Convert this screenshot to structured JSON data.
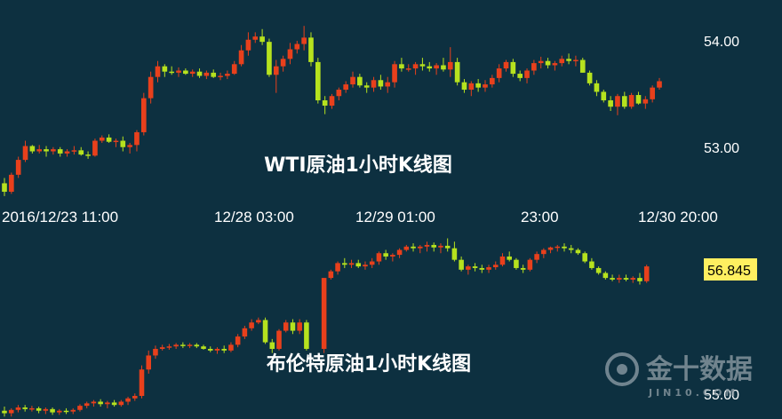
{
  "colors": {
    "background": "#0d3040",
    "up": "#e8401c",
    "down": "#b6e21e",
    "badge": "#ffef60"
  },
  "x_axis": {
    "tick_labels": [
      "2016/12/23 11:00",
      "12/28 03:00",
      "12/29 01:00",
      "23:00",
      "12/30 20:00"
    ]
  },
  "watermark": {
    "name": "金十数据",
    "sub": "JIN10.COM",
    "icon": "jin10-logo-icon"
  },
  "chart_data": [
    {
      "type": "candlestick",
      "title": "WTI原油1小时K线图",
      "yticks": [
        53.0,
        54.0
      ],
      "ytick_labels": [
        "53.00",
        "54.00"
      ],
      "ylim": [
        52.62,
        54.34
      ],
      "grid": false,
      "candles": [
        [
          52.8,
          52.85,
          52.68,
          52.72
        ],
        [
          52.72,
          52.9,
          52.7,
          52.88
        ],
        [
          52.88,
          53.05,
          52.85,
          53.02
        ],
        [
          53.02,
          53.2,
          53.0,
          53.15
        ],
        [
          53.15,
          53.16,
          53.08,
          53.1
        ],
        [
          53.1,
          53.16,
          53.08,
          53.12
        ],
        [
          53.12,
          53.15,
          53.05,
          53.1
        ],
        [
          53.1,
          53.14,
          53.07,
          53.12
        ],
        [
          53.12,
          53.14,
          53.05,
          53.08
        ],
        [
          53.08,
          53.12,
          53.05,
          53.1
        ],
        [
          53.1,
          53.15,
          53.07,
          53.11
        ],
        [
          53.11,
          53.14,
          53.06,
          53.07
        ],
        [
          53.07,
          53.1,
          53.03,
          53.06
        ],
        [
          53.06,
          53.22,
          53.05,
          53.2
        ],
        [
          53.2,
          53.25,
          53.18,
          53.23
        ],
        [
          53.23,
          53.26,
          53.18,
          53.19
        ],
        [
          53.19,
          53.22,
          53.14,
          53.2
        ],
        [
          53.2,
          53.24,
          53.1,
          53.14
        ],
        [
          53.14,
          53.18,
          53.08,
          53.16
        ],
        [
          53.16,
          53.3,
          53.1,
          53.28
        ],
        [
          53.28,
          53.65,
          53.25,
          53.6
        ],
        [
          53.6,
          53.85,
          53.55,
          53.8
        ],
        [
          53.8,
          53.95,
          53.75,
          53.9
        ],
        [
          53.9,
          53.92,
          53.8,
          53.85
        ],
        [
          53.85,
          53.9,
          53.82,
          53.84
        ],
        [
          53.84,
          53.89,
          53.8,
          53.86
        ],
        [
          53.86,
          53.88,
          53.82,
          53.83
        ],
        [
          53.83,
          53.87,
          53.8,
          53.85
        ],
        [
          53.85,
          53.88,
          53.79,
          53.81
        ],
        [
          53.81,
          53.86,
          53.78,
          53.84
        ],
        [
          53.84,
          53.87,
          53.79,
          53.8
        ],
        [
          53.8,
          53.84,
          53.77,
          53.81
        ],
        [
          53.81,
          53.86,
          53.78,
          53.83
        ],
        [
          53.83,
          53.95,
          53.82,
          53.92
        ],
        [
          53.92,
          54.1,
          53.9,
          54.05
        ],
        [
          54.05,
          54.22,
          54.0,
          54.15
        ],
        [
          54.15,
          54.22,
          54.12,
          54.18
        ],
        [
          54.18,
          54.25,
          54.1,
          54.13
        ],
        [
          54.13,
          54.16,
          53.8,
          53.82
        ],
        [
          53.82,
          53.96,
          53.65,
          53.9
        ],
        [
          53.9,
          54.0,
          53.85,
          53.97
        ],
        [
          53.97,
          54.12,
          53.92,
          54.06
        ],
        [
          54.06,
          54.14,
          54.02,
          54.11
        ],
        [
          54.11,
          54.28,
          54.05,
          54.17
        ],
        [
          54.17,
          54.22,
          53.9,
          53.94
        ],
        [
          53.94,
          53.98,
          53.55,
          53.58
        ],
        [
          53.58,
          53.62,
          53.45,
          53.53
        ],
        [
          53.53,
          53.64,
          53.5,
          53.62
        ],
        [
          53.62,
          53.7,
          53.58,
          53.68
        ],
        [
          53.68,
          53.76,
          53.65,
          53.73
        ],
        [
          53.73,
          53.85,
          53.7,
          53.8
        ],
        [
          53.8,
          53.83,
          53.7,
          53.72
        ],
        [
          53.72,
          53.75,
          53.65,
          53.7
        ],
        [
          53.7,
          53.8,
          53.66,
          53.77
        ],
        [
          53.77,
          53.82,
          53.68,
          53.71
        ],
        [
          53.71,
          53.8,
          53.65,
          53.75
        ],
        [
          53.75,
          53.95,
          53.7,
          53.92
        ],
        [
          53.92,
          53.98,
          53.85,
          53.88
        ],
        [
          53.88,
          53.92,
          53.85,
          53.88
        ],
        [
          53.88,
          53.94,
          53.82,
          53.92
        ],
        [
          53.92,
          53.98,
          53.86,
          53.9
        ],
        [
          53.9,
          53.94,
          53.85,
          53.88
        ],
        [
          53.88,
          53.93,
          53.82,
          53.91
        ],
        [
          53.91,
          53.98,
          53.85,
          53.87
        ],
        [
          53.87,
          54.08,
          53.8,
          53.94
        ],
        [
          53.94,
          53.98,
          53.72,
          53.75
        ],
        [
          53.75,
          53.78,
          53.65,
          53.68
        ],
        [
          53.68,
          53.76,
          53.62,
          53.74
        ],
        [
          53.74,
          53.78,
          53.66,
          53.7
        ],
        [
          53.7,
          53.77,
          53.66,
          53.73
        ],
        [
          53.73,
          53.82,
          53.7,
          53.79
        ],
        [
          53.79,
          53.92,
          53.75,
          53.88
        ],
        [
          53.88,
          53.96,
          53.85,
          53.94
        ],
        [
          53.94,
          53.97,
          53.8,
          53.83
        ],
        [
          53.83,
          53.86,
          53.76,
          53.79
        ],
        [
          53.79,
          53.88,
          53.74,
          53.86
        ],
        [
          53.86,
          53.96,
          53.82,
          53.93
        ],
        [
          53.93,
          53.99,
          53.88,
          53.95
        ],
        [
          53.95,
          53.98,
          53.88,
          53.91
        ],
        [
          53.91,
          53.95,
          53.86,
          53.93
        ],
        [
          53.93,
          54.0,
          53.9,
          53.97
        ],
        [
          53.97,
          54.02,
          53.92,
          53.95
        ],
        [
          53.95,
          54.0,
          53.9,
          53.96
        ],
        [
          53.96,
          53.98,
          53.84,
          53.84
        ],
        [
          53.84,
          53.86,
          53.72,
          53.74
        ],
        [
          53.74,
          53.77,
          53.62,
          53.66
        ],
        [
          53.66,
          53.68,
          53.56,
          53.58
        ],
        [
          53.58,
          53.62,
          53.48,
          53.52
        ],
        [
          53.52,
          53.64,
          53.44,
          53.62
        ],
        [
          53.62,
          53.66,
          53.5,
          53.52
        ],
        [
          53.52,
          53.65,
          53.5,
          53.63
        ],
        [
          53.63,
          53.66,
          53.54,
          53.55
        ],
        [
          53.55,
          53.62,
          53.5,
          53.59
        ],
        [
          53.59,
          53.72,
          53.56,
          53.7
        ],
        [
          53.7,
          53.79,
          53.68,
          53.76
        ]
      ]
    },
    {
      "type": "candlestick",
      "title": "布伦特原油1小时K线图",
      "yticks": [
        55.0
      ],
      "ytick_labels": [
        "55.00"
      ],
      "last_price_label": "56.845",
      "ylim": [
        54.95,
        57.21
      ],
      "grid": false,
      "candles": [
        [
          55.05,
          55.1,
          54.98,
          55.02
        ],
        [
          55.02,
          55.08,
          54.98,
          55.06
        ],
        [
          55.06,
          55.12,
          55.03,
          55.09
        ],
        [
          55.09,
          55.12,
          55.04,
          55.07
        ],
        [
          55.07,
          55.11,
          55.04,
          55.08
        ],
        [
          55.08,
          55.1,
          55.02,
          55.05
        ],
        [
          55.05,
          55.09,
          55.01,
          55.07
        ],
        [
          55.07,
          55.09,
          55.0,
          55.03
        ],
        [
          55.03,
          55.07,
          55.0,
          55.05
        ],
        [
          55.05,
          55.08,
          55.01,
          55.04
        ],
        [
          55.04,
          55.08,
          55.01,
          55.06
        ],
        [
          55.06,
          55.13,
          55.04,
          55.11
        ],
        [
          55.11,
          55.16,
          55.08,
          55.14
        ],
        [
          55.14,
          55.18,
          55.1,
          55.16
        ],
        [
          55.16,
          55.19,
          55.1,
          55.13
        ],
        [
          55.13,
          55.17,
          55.08,
          55.15
        ],
        [
          55.15,
          55.18,
          55.1,
          55.12
        ],
        [
          55.12,
          55.18,
          55.1,
          55.16
        ],
        [
          55.16,
          55.22,
          55.12,
          55.2
        ],
        [
          55.2,
          55.26,
          55.17,
          55.23
        ],
        [
          55.23,
          55.6,
          55.2,
          55.55
        ],
        [
          55.55,
          55.78,
          55.5,
          55.72
        ],
        [
          55.72,
          55.84,
          55.68,
          55.8
        ],
        [
          55.8,
          55.85,
          55.78,
          55.82
        ],
        [
          55.82,
          55.86,
          55.79,
          55.83
        ],
        [
          55.83,
          55.87,
          55.8,
          55.85
        ],
        [
          55.85,
          55.88,
          55.81,
          55.84
        ],
        [
          55.84,
          55.87,
          55.81,
          55.85
        ],
        [
          55.85,
          55.87,
          55.81,
          55.83
        ],
        [
          55.83,
          55.85,
          55.79,
          55.8
        ],
        [
          55.8,
          55.83,
          55.76,
          55.78
        ],
        [
          55.78,
          55.82,
          55.74,
          55.8
        ],
        [
          55.8,
          55.84,
          55.75,
          55.78
        ],
        [
          55.78,
          55.88,
          55.76,
          55.85
        ],
        [
          55.85,
          55.98,
          55.82,
          55.95
        ],
        [
          55.95,
          56.08,
          55.92,
          56.05
        ],
        [
          56.05,
          56.16,
          56.02,
          56.12
        ],
        [
          56.12,
          56.18,
          56.1,
          56.15
        ],
        [
          56.15,
          56.18,
          55.86,
          55.88
        ],
        [
          55.88,
          55.92,
          55.75,
          55.8
        ],
        [
          55.8,
          56.04,
          55.78,
          56.02
        ],
        [
          56.02,
          56.15,
          56.0,
          56.12
        ],
        [
          56.12,
          56.16,
          55.98,
          56.02
        ],
        [
          56.02,
          56.16,
          55.98,
          56.12
        ],
        [
          56.12,
          56.15,
          55.78,
          55.8
        ],
        [
          55.8,
          56.66,
          55.75,
          56.66
        ],
        [
          56.66,
          56.76,
          56.64,
          56.74
        ],
        [
          56.74,
          56.86,
          56.7,
          56.84
        ],
        [
          56.84,
          56.9,
          56.78,
          56.82
        ],
        [
          56.82,
          56.88,
          56.78,
          56.84
        ],
        [
          56.84,
          56.88,
          56.78,
          56.8
        ],
        [
          56.8,
          56.86,
          56.76,
          56.82
        ],
        [
          56.82,
          56.9,
          56.78,
          56.86
        ],
        [
          56.86,
          56.98,
          56.82,
          56.96
        ],
        [
          56.96,
          57.0,
          56.88,
          56.92
        ],
        [
          56.92,
          56.96,
          56.86,
          56.94
        ],
        [
          56.94,
          57.02,
          56.9,
          57.0
        ],
        [
          57.0,
          57.06,
          56.98,
          57.04
        ],
        [
          57.04,
          57.08,
          56.98,
          57.02
        ],
        [
          57.02,
          57.06,
          56.96,
          57.04
        ],
        [
          57.04,
          57.1,
          56.98,
          57.06
        ],
        [
          57.06,
          57.09,
          56.98,
          57.03
        ],
        [
          57.03,
          57.08,
          56.96,
          57.05
        ],
        [
          57.05,
          57.14,
          56.98,
          57.02
        ],
        [
          57.02,
          57.1,
          56.86,
          56.88
        ],
        [
          56.88,
          56.92,
          56.74,
          56.76
        ],
        [
          56.76,
          56.82,
          56.7,
          56.8
        ],
        [
          56.8,
          56.84,
          56.74,
          56.78
        ],
        [
          56.78,
          56.82,
          56.72,
          56.76
        ],
        [
          56.76,
          56.82,
          56.72,
          56.79
        ],
        [
          56.79,
          56.86,
          56.76,
          56.82
        ],
        [
          56.82,
          56.96,
          56.8,
          56.92
        ],
        [
          56.92,
          56.98,
          56.86,
          56.88
        ],
        [
          56.88,
          56.9,
          56.76,
          56.78
        ],
        [
          56.78,
          56.82,
          56.72,
          56.76
        ],
        [
          56.76,
          56.9,
          56.74,
          56.88
        ],
        [
          56.88,
          56.98,
          56.84,
          56.95
        ],
        [
          56.95,
          57.02,
          56.9,
          57.0
        ],
        [
          57.0,
          57.04,
          56.96,
          57.03
        ],
        [
          57.03,
          57.06,
          56.98,
          57.04
        ],
        [
          57.04,
          57.08,
          56.98,
          57.02
        ],
        [
          57.02,
          57.06,
          56.96,
          57.0
        ],
        [
          57.0,
          57.02,
          56.94,
          56.96
        ],
        [
          56.96,
          56.98,
          56.84,
          56.86
        ],
        [
          56.86,
          56.9,
          56.76,
          56.78
        ],
        [
          56.78,
          56.8,
          56.7,
          56.72
        ],
        [
          56.72,
          56.74,
          56.64,
          56.66
        ],
        [
          56.66,
          56.7,
          56.62,
          56.64
        ],
        [
          56.64,
          56.7,
          56.6,
          56.66
        ],
        [
          56.66,
          56.7,
          56.62,
          56.64
        ],
        [
          56.64,
          56.68,
          56.6,
          56.66
        ],
        [
          56.66,
          56.72,
          56.58,
          56.62
        ],
        [
          56.62,
          56.82,
          56.6,
          56.8
        ]
      ]
    }
  ]
}
